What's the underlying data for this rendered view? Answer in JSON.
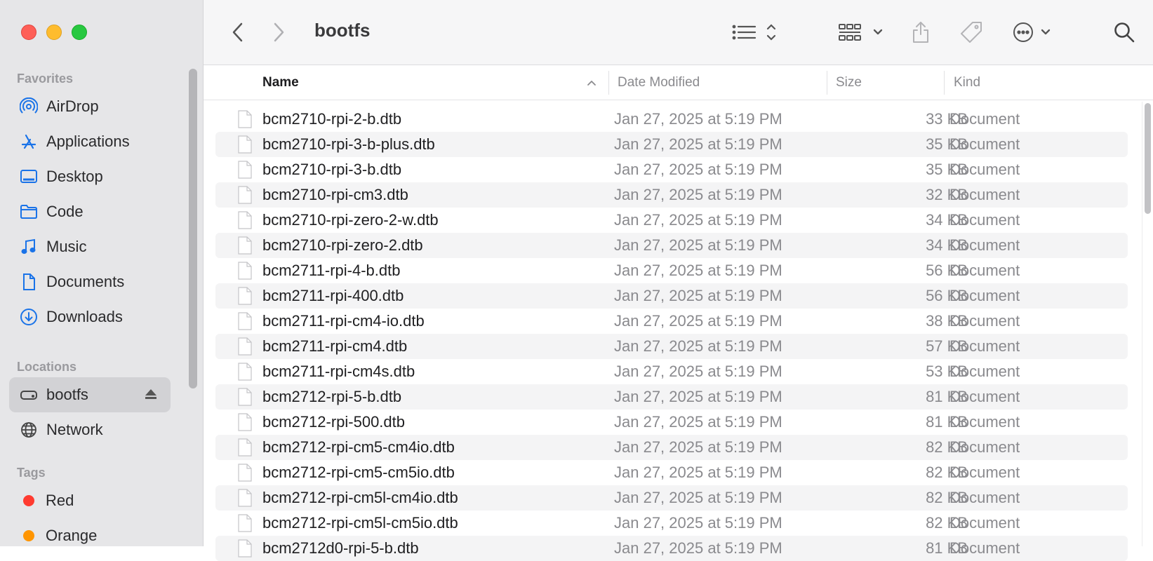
{
  "window": {
    "title": "bootfs"
  },
  "sidebar": {
    "favorites_header": "Favorites",
    "favorites": [
      {
        "label": "AirDrop",
        "icon": "airdrop-icon"
      },
      {
        "label": "Applications",
        "icon": "applications-icon"
      },
      {
        "label": "Desktop",
        "icon": "desktop-icon"
      },
      {
        "label": "Code",
        "icon": "folder-icon"
      },
      {
        "label": "Music",
        "icon": "music-icon"
      },
      {
        "label": "Documents",
        "icon": "document-icon"
      },
      {
        "label": "Downloads",
        "icon": "downloads-icon"
      }
    ],
    "locations_header": "Locations",
    "locations": [
      {
        "label": "bootfs",
        "icon": "drive-icon",
        "selected": true
      },
      {
        "label": "Network",
        "icon": "network-icon"
      }
    ],
    "tags_header": "Tags",
    "tags": [
      {
        "label": "Red",
        "color": "#ff3b30"
      },
      {
        "label": "Orange",
        "color": "#ff9500"
      }
    ]
  },
  "columns": {
    "name": "Name",
    "date": "Date Modified",
    "size": "Size",
    "kind": "Kind"
  },
  "files": [
    {
      "name": "bcm2710-rpi-2-b.dtb",
      "date": "Jan 27, 2025 at 5:19 PM",
      "size": "33 KB",
      "kind": "Document"
    },
    {
      "name": "bcm2710-rpi-3-b-plus.dtb",
      "date": "Jan 27, 2025 at 5:19 PM",
      "size": "35 KB",
      "kind": "Document"
    },
    {
      "name": "bcm2710-rpi-3-b.dtb",
      "date": "Jan 27, 2025 at 5:19 PM",
      "size": "35 KB",
      "kind": "Document"
    },
    {
      "name": "bcm2710-rpi-cm3.dtb",
      "date": "Jan 27, 2025 at 5:19 PM",
      "size": "32 KB",
      "kind": "Document"
    },
    {
      "name": "bcm2710-rpi-zero-2-w.dtb",
      "date": "Jan 27, 2025 at 5:19 PM",
      "size": "34 KB",
      "kind": "Document"
    },
    {
      "name": "bcm2710-rpi-zero-2.dtb",
      "date": "Jan 27, 2025 at 5:19 PM",
      "size": "34 KB",
      "kind": "Document"
    },
    {
      "name": "bcm2711-rpi-4-b.dtb",
      "date": "Jan 27, 2025 at 5:19 PM",
      "size": "56 KB",
      "kind": "Document"
    },
    {
      "name": "bcm2711-rpi-400.dtb",
      "date": "Jan 27, 2025 at 5:19 PM",
      "size": "56 KB",
      "kind": "Document"
    },
    {
      "name": "bcm2711-rpi-cm4-io.dtb",
      "date": "Jan 27, 2025 at 5:19 PM",
      "size": "38 KB",
      "kind": "Document"
    },
    {
      "name": "bcm2711-rpi-cm4.dtb",
      "date": "Jan 27, 2025 at 5:19 PM",
      "size": "57 KB",
      "kind": "Document"
    },
    {
      "name": "bcm2711-rpi-cm4s.dtb",
      "date": "Jan 27, 2025 at 5:19 PM",
      "size": "53 KB",
      "kind": "Document"
    },
    {
      "name": "bcm2712-rpi-5-b.dtb",
      "date": "Jan 27, 2025 at 5:19 PM",
      "size": "81 KB",
      "kind": "Document"
    },
    {
      "name": "bcm2712-rpi-500.dtb",
      "date": "Jan 27, 2025 at 5:19 PM",
      "size": "81 KB",
      "kind": "Document"
    },
    {
      "name": "bcm2712-rpi-cm5-cm4io.dtb",
      "date": "Jan 27, 2025 at 5:19 PM",
      "size": "82 KB",
      "kind": "Document"
    },
    {
      "name": "bcm2712-rpi-cm5-cm5io.dtb",
      "date": "Jan 27, 2025 at 5:19 PM",
      "size": "82 KB",
      "kind": "Document"
    },
    {
      "name": "bcm2712-rpi-cm5l-cm4io.dtb",
      "date": "Jan 27, 2025 at 5:19 PM",
      "size": "82 KB",
      "kind": "Document"
    },
    {
      "name": "bcm2712-rpi-cm5l-cm5io.dtb",
      "date": "Jan 27, 2025 at 5:19 PM",
      "size": "82 KB",
      "kind": "Document"
    },
    {
      "name": "bcm2712d0-rpi-5-b.dtb",
      "date": "Jan 27, 2025 at 5:19 PM",
      "size": "81 KB",
      "kind": "Document"
    }
  ],
  "colors": {
    "accent": "#1a73e8",
    "sidebar_bg": "#e6e6e8"
  }
}
